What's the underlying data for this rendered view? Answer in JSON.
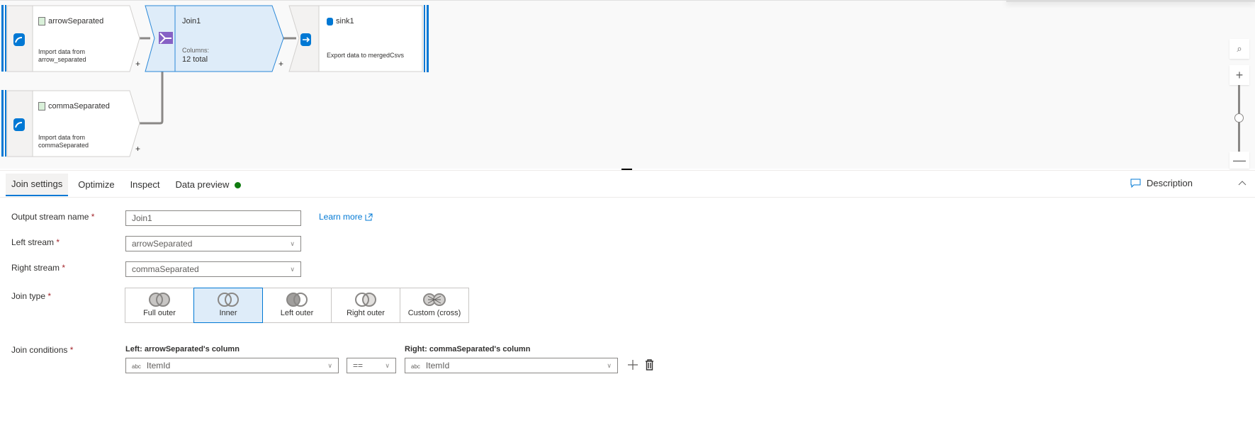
{
  "canvas": {
    "nodes": [
      {
        "id": "arrowSeparated",
        "title": "arrowSeparated",
        "desc_line1": "Import data from",
        "desc_line2": "arrow_separated",
        "type": "source"
      },
      {
        "id": "commaSeparated",
        "title": "commaSeparated",
        "desc_line1": "Import data from",
        "desc_line2": "commaSeparated",
        "type": "source"
      },
      {
        "id": "Join1",
        "title": "Join1",
        "columns_label": "Columns:",
        "columns_value": "12 total",
        "type": "join"
      },
      {
        "id": "sink1",
        "title": "sink1",
        "desc_line1": "Export data to mergedCsvs",
        "type": "sink"
      }
    ],
    "add_symbol": "+",
    "zoom": {
      "search": "⌕",
      "zoom_in": "+",
      "zoom_out": "—",
      "level": 0.5
    }
  },
  "panel": {
    "tabs": [
      {
        "label": "Join settings",
        "active": true
      },
      {
        "label": "Optimize"
      },
      {
        "label": "Inspect"
      },
      {
        "label": "Data preview",
        "status": "green"
      }
    ],
    "description_label": "Description",
    "collapse_glyph": "^",
    "form": {
      "output_stream_label": "Output stream name",
      "output_stream_value": "Join1",
      "learn_more": "Learn more",
      "left_stream_label": "Left stream",
      "left_stream_value": "arrowSeparated",
      "right_stream_label": "Right stream",
      "right_stream_value": "commaSeparated",
      "join_type_label": "Join type",
      "join_types": [
        "Full outer",
        "Inner",
        "Left outer",
        "Right outer",
        "Custom (cross)"
      ],
      "join_type_selected": "Inner",
      "join_conditions_label": "Join conditions",
      "left_col_header": "Left: arrowSeparated's column",
      "right_col_header": "Right: commaSeparated's column",
      "left_col_type": "abc",
      "left_col_value": "ItemId",
      "operator": "==",
      "right_col_type": "abc",
      "right_col_value": "ItemId",
      "required_mark": "*"
    }
  },
  "colors": {
    "accent": "#0078d4",
    "selected_bg": "#deecf9",
    "status_green": "#107c10",
    "required": "#a4262c"
  }
}
